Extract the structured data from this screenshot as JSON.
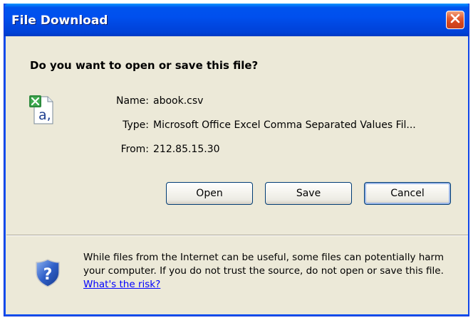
{
  "window": {
    "title": "File Download"
  },
  "dialog": {
    "question": "Do you want to open or save this file?",
    "file_icon": "excel-csv-file-icon",
    "fields": [
      {
        "label": "Name:",
        "value": "abook.csv"
      },
      {
        "label": "Type:",
        "value": "Microsoft Office Excel Comma Separated Values Fil..."
      },
      {
        "label": "From:",
        "value": "212.85.15.30"
      }
    ],
    "buttons": {
      "open_label": "Open",
      "save_label": "Save",
      "cancel_label": "Cancel"
    },
    "warning": {
      "icon": "security-shield-question-icon",
      "text": "While files from the Internet can be useful, some files can potentially harm your computer. If you do not trust the source, do not open or save this file.",
      "link_text": "What's the risk?"
    }
  },
  "colors": {
    "titlebar": "#0054e3",
    "dialog_bg": "#ece9d8",
    "close_button": "#e25b33",
    "link": "#0000ff"
  }
}
